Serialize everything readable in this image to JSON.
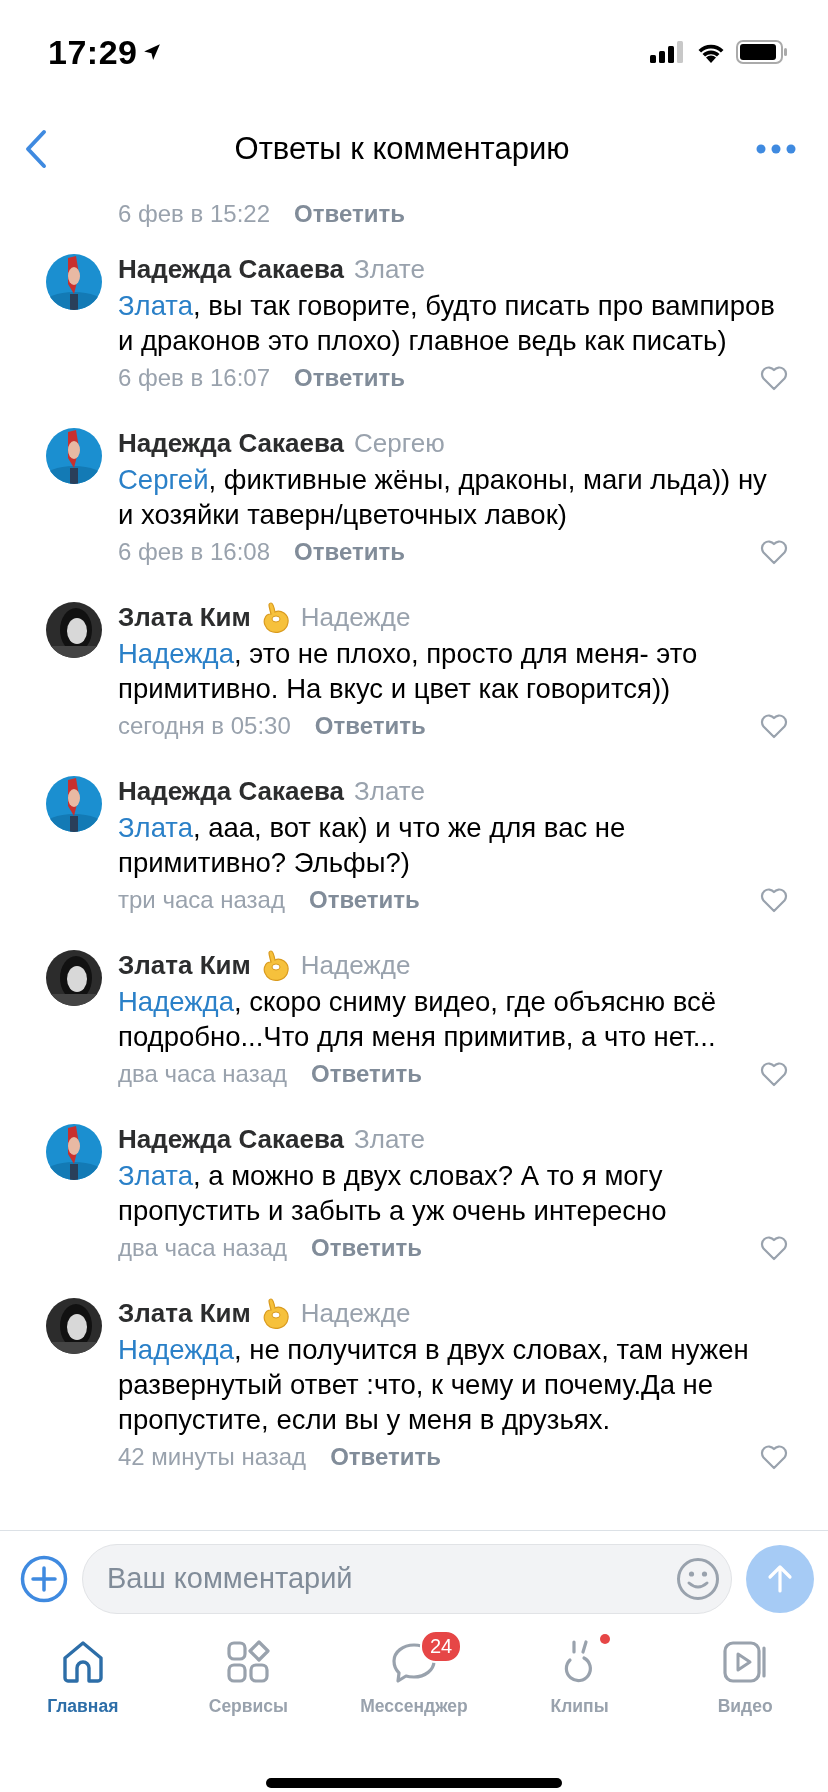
{
  "status_bar": {
    "time": "17:29"
  },
  "header": {
    "title": "Ответы к комментарию"
  },
  "partial_comment": {
    "time": "6 фев в 15:22",
    "reply": "Ответить"
  },
  "comments": [
    {
      "author": "Надежда Сакаева",
      "emoji_badge": false,
      "addressee": "Злате",
      "mention": "Злата",
      "text": ", вы так говорите, будто писать про вампиров и драконов это плохо) главное ведь как писать)",
      "time": "6 фев в 16:07",
      "reply": "Ответить",
      "liked": false
    },
    {
      "author": "Надежда Сакаева",
      "emoji_badge": false,
      "addressee": "Сергею",
      "mention": "Сергей",
      "text": ", фиктивные жёны, драконы, маги льда)) ну и хозяйки таверн/цветочных лавок)",
      "time": "6 фев в 16:08",
      "reply": "Ответить",
      "liked": false
    },
    {
      "author": "Злата Ким",
      "emoji_badge": true,
      "addressee": "Надежде",
      "mention": "Надежда",
      "text": ", это не плохо, просто для меня- это примитивно. На вкус и цвет как говорится))",
      "time": "сегодня в 05:30",
      "reply": "Ответить",
      "liked": false
    },
    {
      "author": "Надежда Сакаева",
      "emoji_badge": false,
      "addressee": "Злате",
      "mention": "Злата",
      "text": ", ааа, вот как) и что же для вас не примитивно? Эльфы?)",
      "time": "три часа назад",
      "reply": "Ответить",
      "liked": false
    },
    {
      "author": "Злата Ким",
      "emoji_badge": true,
      "addressee": "Надежде",
      "mention": "Надежда",
      "text": ", скоро сниму видео, где объясню всё подробно...Что для меня примитив, а что нет...",
      "time": "два часа назад",
      "reply": "Ответить",
      "liked": false
    },
    {
      "author": "Надежда Сакаева",
      "emoji_badge": false,
      "addressee": "Злате",
      "mention": "Злата",
      "text": ", а можно в двух словах? А то я могу пропустить и забыть а уж очень интересно",
      "time": "два часа назад",
      "reply": "Ответить",
      "liked": false
    },
    {
      "author": "Злата Ким",
      "emoji_badge": true,
      "addressee": "Надежде",
      "mention": "Надежда",
      "text": ", не получится в двух словах, там нужен развернутый ответ :что, к чему и почему.Да не пропустите, если вы у меня в друзьях.",
      "time": "42 минуты назад",
      "reply": "Ответить",
      "liked": false
    }
  ],
  "composer": {
    "placeholder": "Ваш комментарий"
  },
  "tabs": [
    {
      "kind": "home",
      "label": "Главная",
      "selected": true
    },
    {
      "kind": "services",
      "label": "Сервисы",
      "selected": false
    },
    {
      "kind": "messenger",
      "label": "Мессенджер",
      "selected": false,
      "badge": "24"
    },
    {
      "kind": "clips",
      "label": "Клипы",
      "selected": false,
      "dot": true
    },
    {
      "kind": "video",
      "label": "Видео",
      "selected": false
    }
  ]
}
